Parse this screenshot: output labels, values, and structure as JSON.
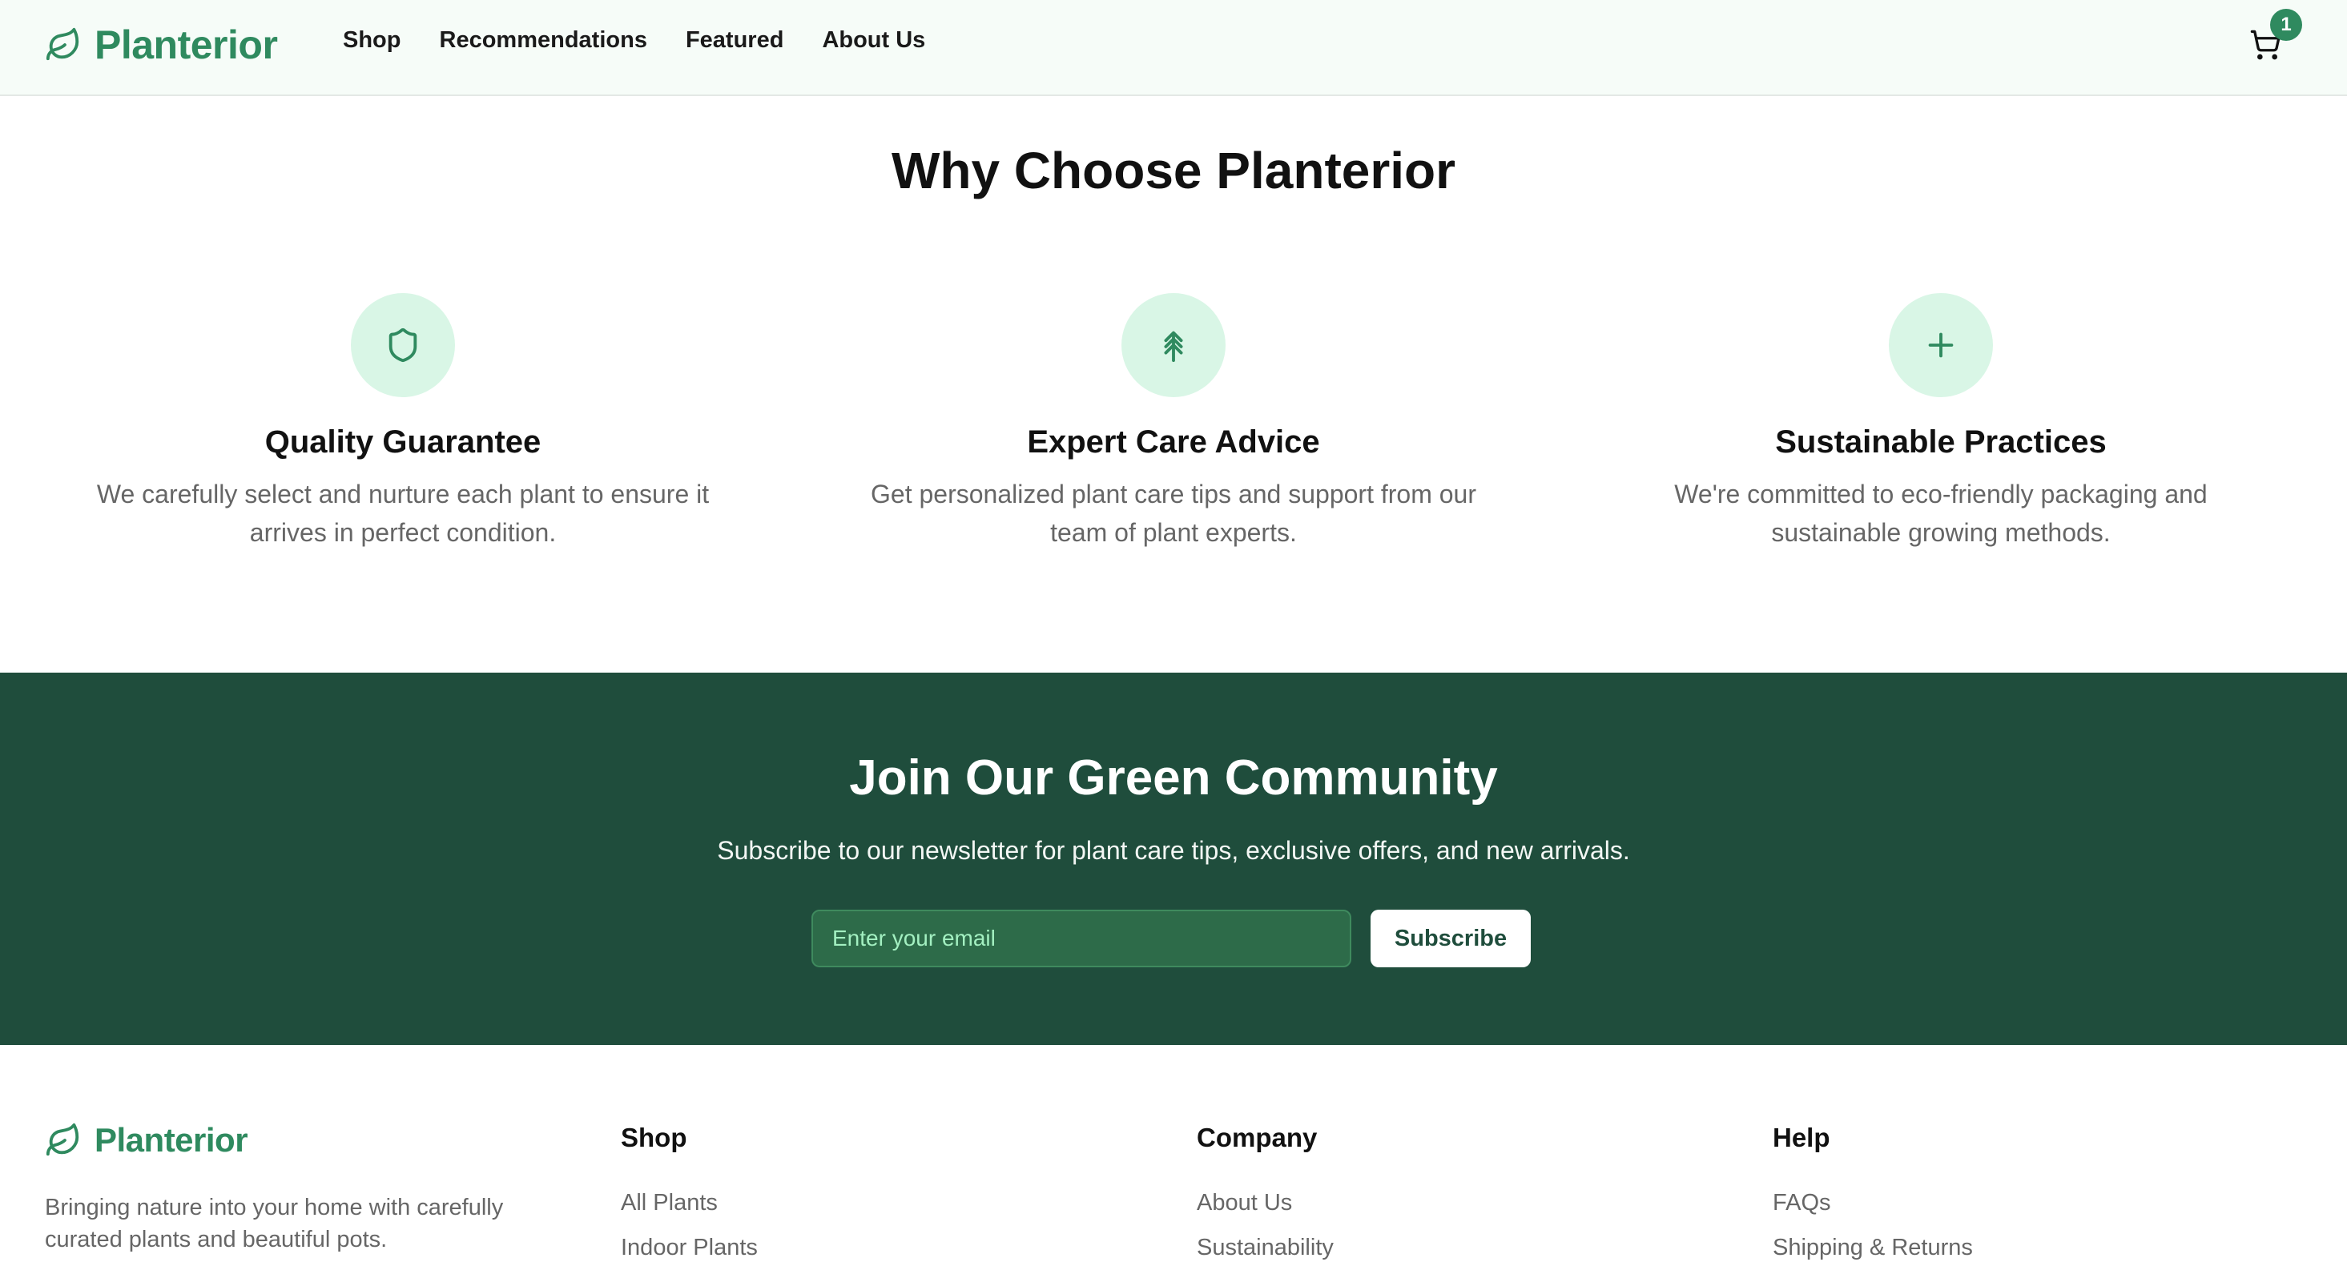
{
  "header": {
    "brand": "Planterior",
    "nav": [
      "Shop",
      "Recommendations",
      "Featured",
      "About Us"
    ],
    "cart_count": "1"
  },
  "why": {
    "title": "Why Choose Planterior",
    "features": [
      {
        "icon": "shield-icon",
        "title": "Quality Guarantee",
        "text": "We carefully select and nurture each plant to ensure it arrives in perfect condition."
      },
      {
        "icon": "tree-icon",
        "title": "Expert Care Advice",
        "text": "Get personalized plant care tips and support from our team of plant experts."
      },
      {
        "icon": "plus-icon",
        "title": "Sustainable Practices",
        "text": "We're committed to eco-friendly packaging and sustainable growing methods."
      }
    ]
  },
  "community": {
    "title": "Join Our Green Community",
    "subtitle": "Subscribe to our newsletter for plant care tips, exclusive offers, and new arrivals.",
    "email_placeholder": "Enter your email",
    "button": "Subscribe"
  },
  "footer": {
    "brand": "Planterior",
    "description": "Bringing nature into your home with carefully curated plants and beautiful pots.",
    "columns": [
      {
        "title": "Shop",
        "links": [
          "All Plants",
          "Indoor Plants"
        ]
      },
      {
        "title": "Company",
        "links": [
          "About Us",
          "Sustainability"
        ]
      },
      {
        "title": "Help",
        "links": [
          "FAQs",
          "Shipping & Returns"
        ]
      }
    ]
  },
  "colors": {
    "brand_green": "#2f8a5f",
    "community_bg": "#1f4d3c",
    "icon_circle_bg": "#d9f6e6"
  }
}
